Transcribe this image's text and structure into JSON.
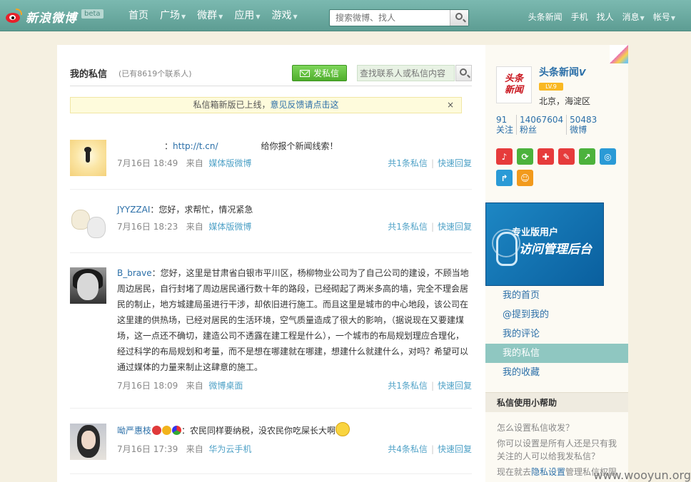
{
  "header": {
    "logo_text": "新浪微博",
    "beta": "beta",
    "nav": [
      {
        "label": "首页",
        "caret": false
      },
      {
        "label": "广场",
        "caret": true
      },
      {
        "label": "微群",
        "caret": true
      },
      {
        "label": "应用",
        "caret": true
      },
      {
        "label": "游戏",
        "caret": true
      }
    ],
    "search_placeholder": "搜索微博、找人",
    "right_links": [
      {
        "label": "头条新闻",
        "caret": false
      },
      {
        "label": "手机",
        "caret": false
      },
      {
        "label": "找人",
        "caret": false
      },
      {
        "label": "消息",
        "caret": true
      },
      {
        "label": "帐号",
        "caret": true
      }
    ],
    "caret_glyph": "▼"
  },
  "pm": {
    "title": "我的私信",
    "count": "(已有8619个联系人)",
    "send_label": "发私信",
    "contact_search_placeholder": "查找联系人或私信内容",
    "notice_text": "私信箱新版已上线，",
    "notice_link": "意见反馈请点击这",
    "notice_close": "×"
  },
  "messages": [
    {
      "sender": "",
      "text_parts": [
        "：",
        "http://t.cn/",
        "　　　　　给你报个新闻线索！"
      ],
      "time": "7月16日 18:49",
      "from_label": "来自",
      "source": "媒体版微博",
      "count": "共1条私信",
      "reply": "快速回复"
    },
    {
      "sender": "JYYZZAI",
      "text": "：您好，求帮忙，情况紧急",
      "time": "7月16日 18:23",
      "from_label": "来自",
      "source": "媒体版微博",
      "count": "共1条私信",
      "reply": "快速回复"
    },
    {
      "sender": "B_brave",
      "text": "：您好，这里是甘肃省白银市平川区，杨柳物业公司为了自己公司的建设，不顾当地周边居民，自行封堵了周边居民通行数十年的路段，已经砌起了两米多高的墙，完全不理会居民的制止，地方城建局虽进行干涉，却依旧进行施工。而且这里是城市的中心地段，该公司在这里建的供热场，已经对居民的生活环境，空气质量造成了很大的影响，（据说现在又要建煤场，这一点还不确切，建造公司不透露在建工程是什么），一个城市的布局规划理应合理化，经过科学的布局规划和考量，而不是想在哪建就在哪建，想建什么就建什么，对吗？希望可以通过媒体的力量来制止这肆意的施工。",
      "time": "7月16日 18:09",
      "from_label": "来自",
      "source": "微博桌面",
      "count": "共1条私信",
      "reply": "快速回复"
    },
    {
      "sender": "呦严惠枝",
      "text": "：农民同样要纳税，没农民你吃屎长大啊",
      "time": "7月16日 17:39",
      "from_label": "来自",
      "source": "华为云手机",
      "count": "共4条私信",
      "reply": "快速回复"
    }
  ],
  "sidebar": {
    "avatar_line1": "头条",
    "avatar_line2": "新闻",
    "name": "头条新闻",
    "verified": "V",
    "level": "LV.9",
    "location": "北京，海淀区",
    "stats": [
      {
        "num": "91",
        "label": "关注"
      },
      {
        "num": "14067604",
        "label": "粉丝"
      },
      {
        "num": "50483",
        "label": "微博"
      }
    ],
    "apps": [
      {
        "icon": "microphone-icon",
        "color": "#e63b3b",
        "glyph": "♪"
      },
      {
        "icon": "refresh-icon",
        "color": "#4cb23c",
        "glyph": "⟳"
      },
      {
        "icon": "medical-cross-icon",
        "color": "#e63b3b",
        "glyph": "✚"
      },
      {
        "icon": "pen-icon",
        "color": "#e63b3b",
        "glyph": "✎"
      },
      {
        "icon": "chart-icon",
        "color": "#4cb23c",
        "glyph": "↗"
      },
      {
        "icon": "search-globe-icon",
        "color": "#2a9ad6",
        "glyph": "◎"
      },
      {
        "icon": "share-icon",
        "color": "#2a9ad6",
        "glyph": "↱"
      },
      {
        "icon": "smile-icon",
        "color": "#f29a1c",
        "glyph": "☺"
      }
    ],
    "banner_line1": "专业版用户",
    "banner_line2": "访问管理后台",
    "menu": [
      {
        "label": "我的首页",
        "active": false
      },
      {
        "label": "@提到我的",
        "active": false
      },
      {
        "label": "我的评论",
        "active": false
      },
      {
        "label": "我的私信",
        "active": true
      },
      {
        "label": "我的收藏",
        "active": false
      }
    ],
    "help_title": "私信使用小帮助",
    "help_q1": "怎么设置私信收发？",
    "help_q2": "你可以设置是所有人还是只有我关注的人可以给我发私信？",
    "help_q3_pre": "现在就去",
    "help_q3_link": "隐私设置",
    "help_q3_post": "管理私信权限"
  },
  "watermark": "www.wooyun.org"
}
